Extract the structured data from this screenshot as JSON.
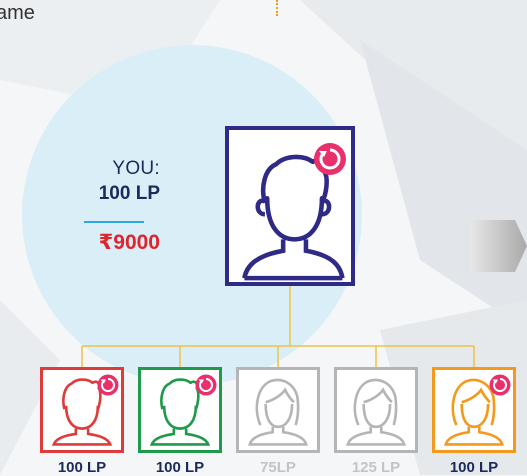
{
  "header": {
    "top_word": "ame"
  },
  "you": {
    "label": "YOU:",
    "lp": "100 LP",
    "amount": "₹9000"
  },
  "main_avatar": {
    "icon": "male-user-icon",
    "badge_icon": "refresh-icon",
    "color": "#2e2a85"
  },
  "children": [
    {
      "lp": "100 LP",
      "color": "#e03b3b",
      "avatar": "male",
      "active": true
    },
    {
      "lp": "100 LP",
      "color": "#1f9a4a",
      "avatar": "male",
      "active": true
    },
    {
      "lp": "75LP",
      "color": "#b5b5b5",
      "avatar": "female",
      "active": false
    },
    {
      "lp": "125 LP",
      "color": "#b5b5b5",
      "avatar": "female",
      "active": false
    },
    {
      "lp": "100 LP",
      "color": "#f39a1e",
      "avatar": "female",
      "active": true
    }
  ],
  "colors": {
    "badge": "#e8306b",
    "connector": "#ecc244",
    "heading_text": "#1a2a5a",
    "amount_text": "#e0242d"
  }
}
